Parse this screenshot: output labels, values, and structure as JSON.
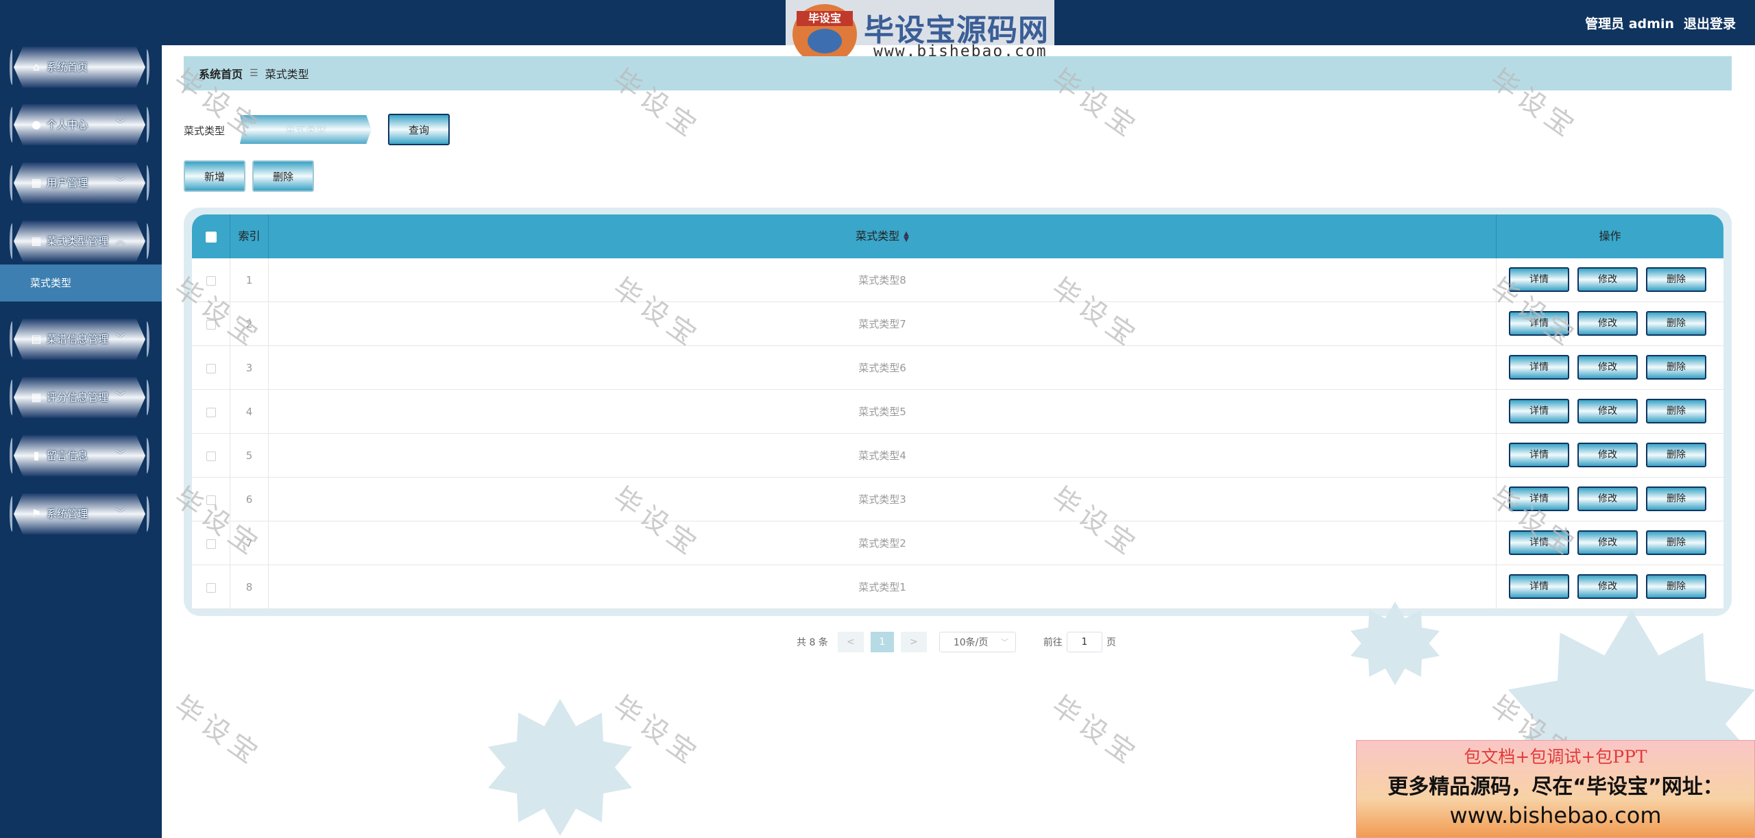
{
  "header": {
    "user_label": "管理员 admin",
    "logout_label": "退出登录"
  },
  "logo": {
    "badge": "毕设宝",
    "title": "毕设宝源码网",
    "url": "www.bishebao.com"
  },
  "sidebar": {
    "items": [
      {
        "label": "系统首页",
        "icon": "home-icon",
        "has_children": false
      },
      {
        "label": "个人中心",
        "icon": "user-icon",
        "has_children": true
      },
      {
        "label": "用户管理",
        "icon": "grid-icon",
        "has_children": true
      },
      {
        "label": "菜式类型管理",
        "icon": "grid-icon",
        "has_children": true,
        "expanded": true
      },
      {
        "label": "菜谱信息管理",
        "icon": "wallet-icon",
        "has_children": true
      },
      {
        "label": "评分信息管理",
        "icon": "grid-icon",
        "has_children": true
      },
      {
        "label": "留言信息",
        "icon": "bar-chart-icon",
        "has_children": true
      },
      {
        "label": "系统管理",
        "icon": "flag-icon",
        "has_children": true
      }
    ],
    "submenu": {
      "label": "菜式类型",
      "active": true
    }
  },
  "breadcrumb": {
    "home": "系统首页",
    "separator": "☰",
    "current": "菜式类型"
  },
  "search": {
    "label": "菜式类型",
    "placeholder": "菜式类型",
    "value": "",
    "query_button": "查询"
  },
  "actions": {
    "add": "新增",
    "delete": "删除"
  },
  "table": {
    "columns": [
      "索引",
      "菜式类型",
      "操作"
    ],
    "rows": [
      {
        "index": "1",
        "type": "菜式类型8"
      },
      {
        "index": "2",
        "type": "菜式类型7"
      },
      {
        "index": "3",
        "type": "菜式类型6"
      },
      {
        "index": "4",
        "type": "菜式类型5"
      },
      {
        "index": "5",
        "type": "菜式类型4"
      },
      {
        "index": "6",
        "type": "菜式类型3"
      },
      {
        "index": "7",
        "type": "菜式类型2"
      },
      {
        "index": "8",
        "type": "菜式类型1"
      }
    ],
    "row_actions": {
      "detail": "详情",
      "edit": "修改",
      "delete": "删除"
    }
  },
  "pagination": {
    "total": "共 8 条",
    "prev": "<",
    "current_page": "1",
    "next": ">",
    "page_size": "10条/页",
    "goto_prefix": "前往",
    "goto_value": "1",
    "goto_suffix": "页"
  },
  "watermark": {
    "text": "毕设宝"
  },
  "promo": {
    "line1": "包文档+包调试+包PPT",
    "line2": "更多精品源码，尽在“毕设宝”网址：",
    "line3": "www.bishebao.com"
  },
  "colors": {
    "nav_bg": "#0f3460",
    "header_row": "#3aa6c9",
    "breadcrumb_bg": "#b6dbe5",
    "submenu_active": "#3d7fb0"
  }
}
